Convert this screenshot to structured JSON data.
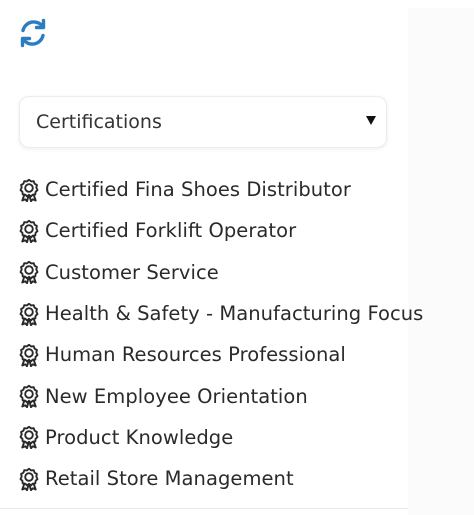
{
  "toolbar": {
    "refresh_icon": "refresh-icon",
    "accent_color": "#2b7cc1"
  },
  "filter": {
    "selected": "Certifications",
    "caret_icon": "caret-down-icon"
  },
  "certifications": {
    "item_icon": "award-badge-icon",
    "items": [
      {
        "label": "Certified Fina Shoes Distributor"
      },
      {
        "label": "Certified Forklift Operator"
      },
      {
        "label": "Customer Service"
      },
      {
        "label": "Health & Safety - Manufacturing Focus"
      },
      {
        "label": "Human Resources Professional"
      },
      {
        "label": "New Employee Orientation"
      },
      {
        "label": "Product Knowledge"
      },
      {
        "label": "Retail Store Management"
      }
    ]
  }
}
